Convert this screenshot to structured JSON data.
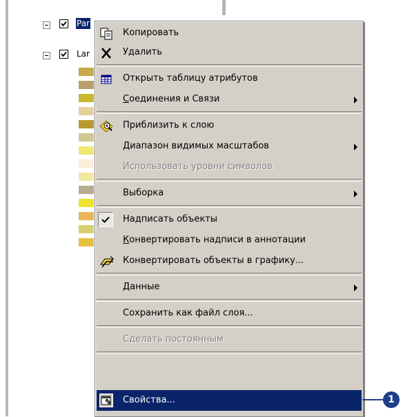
{
  "layers": [
    {
      "name": "Parcels",
      "visible_name": "Par",
      "checked": true,
      "selected": true
    },
    {
      "name": "Land",
      "visible_name": "Lar",
      "checked": true,
      "selected": false
    }
  ],
  "legend_swatch_colors": [
    "#c8a84a",
    "#b89f6e",
    "#c8b830",
    "#e6d0a0",
    "#b89830",
    "#d0c890",
    "#f0e870",
    "#faeed8",
    "#f2e8a0",
    "#b8aa90",
    "#ece430",
    "#e8b85a",
    "#d8d070",
    "#e8c040"
  ],
  "menu": {
    "items": [
      {
        "id": "copy",
        "label": "Копировать",
        "icon": "copy-icon"
      },
      {
        "id": "delete",
        "label": "Удалить",
        "icon": "delete-icon"
      },
      {
        "id": "open-attribute-table",
        "label": "Открыть таблицу атрибутов",
        "icon": "table-icon"
      },
      {
        "id": "joins-relates",
        "label": "Соединения и Связи",
        "submenu": true,
        "accel": "С"
      },
      {
        "id": "zoom-to-layer",
        "label": "Приблизить к слою",
        "icon": "zoom-to-layer-icon"
      },
      {
        "id": "visible-scale-range",
        "label": "Диапазон видимых масштабов",
        "submenu": true
      },
      {
        "id": "use-symbol-levels",
        "label": "Использовать уровни символов",
        "disabled": true
      },
      {
        "id": "selection",
        "label": "Выборка",
        "submenu": true
      },
      {
        "id": "label-features",
        "label": "Надписать объекты",
        "checked": true
      },
      {
        "id": "convert-labels-to-annotation",
        "label": "Конвертировать надписи в аннотации",
        "accel": "К"
      },
      {
        "id": "convert-features-to-graphics",
        "label": "Конвертировать объекты в графику...",
        "icon": "convert-graphics-icon"
      },
      {
        "id": "data",
        "label": "Данные",
        "submenu": true
      },
      {
        "id": "save-as-layer-file",
        "label": "Сохранить как файл слоя..."
      },
      {
        "id": "make-permanent",
        "label": "Сделать постоянным",
        "disabled": true
      },
      {
        "id": "properties",
        "label": "Свойства...",
        "icon": "properties-icon",
        "highlighted": true
      }
    ]
  },
  "callout": {
    "number": "1"
  },
  "colors": {
    "highlight": "#0a246a",
    "menu_bg": "#d4d0c8",
    "callout": "#1e3f88"
  }
}
